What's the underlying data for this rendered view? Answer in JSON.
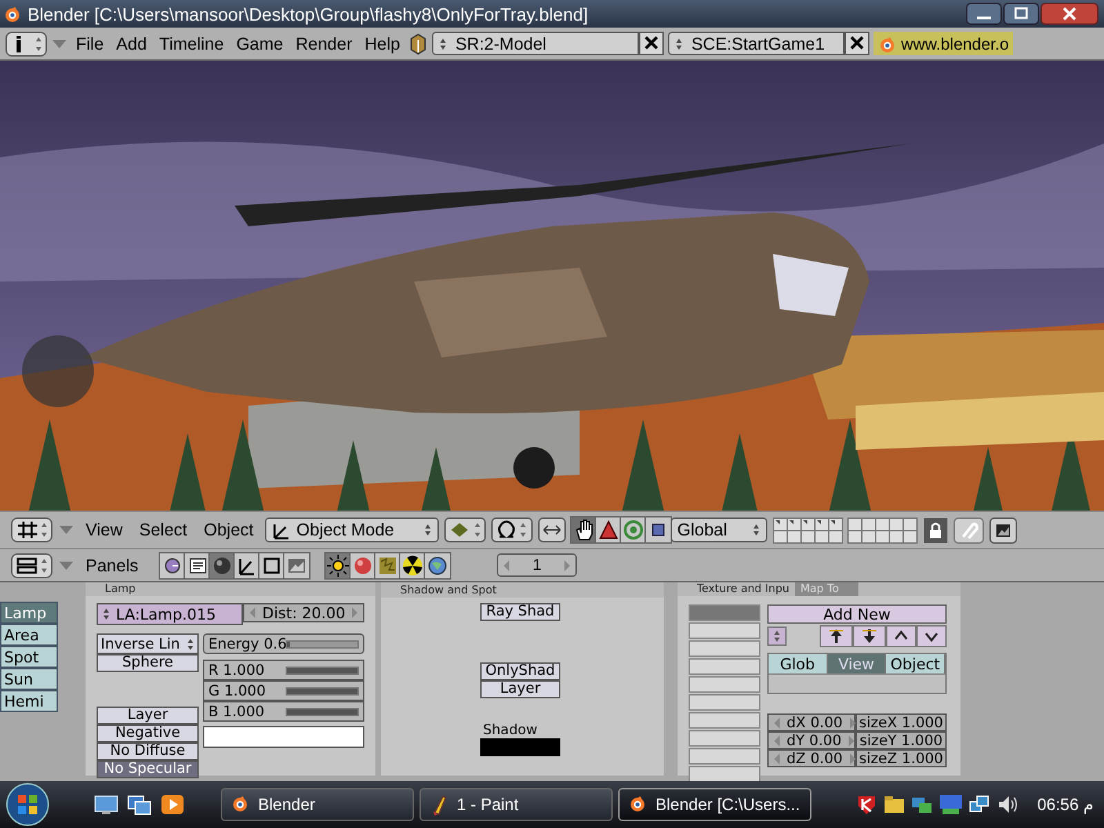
{
  "window": {
    "title": "Blender [C:\\Users\\mansoor\\Desktop\\Group\\flashy8\\OnlyForTray.blend]"
  },
  "info_header": {
    "menus": [
      "File",
      "Add",
      "Timeline",
      "Game",
      "Render",
      "Help"
    ],
    "screen": "SR:2-Model",
    "scene": "SCE:StartGame1",
    "link": "www.blender.o"
  },
  "view3d_header": {
    "menus": [
      "View",
      "Select",
      "Object"
    ],
    "mode": "Object Mode",
    "orientation": "Global",
    "manipulators": [
      {
        "kind": "hand",
        "selected": true
      },
      {
        "kind": "translate",
        "selected": false
      },
      {
        "kind": "rotate",
        "selected": false
      },
      {
        "kind": "scale",
        "selected": false
      }
    ]
  },
  "buttons_header": {
    "label": "Panels",
    "contexts": [
      {
        "kind": "logic",
        "selected": false
      },
      {
        "kind": "script",
        "selected": false
      },
      {
        "kind": "shading",
        "selected": true
      },
      {
        "kind": "object",
        "selected": false
      },
      {
        "kind": "editing",
        "selected": false
      },
      {
        "kind": "scene",
        "selected": false
      }
    ],
    "subcontexts": [
      {
        "kind": "lamp",
        "selected": true
      },
      {
        "kind": "material",
        "selected": false
      },
      {
        "kind": "texture",
        "selected": false
      },
      {
        "kind": "radio",
        "selected": false
      },
      {
        "kind": "world",
        "selected": false
      }
    ],
    "frame": "1"
  },
  "lamp_types": [
    {
      "label": "Lamp",
      "selected": true
    },
    {
      "label": "Area",
      "selected": false
    },
    {
      "label": "Spot",
      "selected": false
    },
    {
      "label": "Sun",
      "selected": false
    },
    {
      "label": "Hemi",
      "selected": false
    }
  ],
  "lamp_panel": {
    "title": "Lamp",
    "name": "LA:Lamp.015",
    "dist": "Dist: 20.00",
    "falloff": "Inverse Lin",
    "sphere": "Sphere",
    "energy": {
      "label": "Energy 0.6",
      "level": 0.03
    },
    "color_sliders": [
      {
        "label": "R 1.000",
        "level": 1
      },
      {
        "label": "G 1.000",
        "level": 1
      },
      {
        "label": "B 1.000",
        "level": 1
      }
    ],
    "color": "#ffffff",
    "toggles": [
      {
        "label": "Layer",
        "on": false
      },
      {
        "label": "Negative",
        "on": false
      },
      {
        "label": "No Diffuse",
        "on": false
      },
      {
        "label": "No Specular",
        "on": true
      }
    ]
  },
  "shadow_panel": {
    "title": "Shadow and Spot",
    "toggles": [
      {
        "label": "Ray Shad",
        "on": false
      },
      {
        "label": "OnlyShad",
        "on": false
      },
      {
        "label": "Layer",
        "on": false
      }
    ],
    "shadow_label": "Shadow"
  },
  "texture_panel": {
    "title": "Texture and Inpu",
    "tab": "Map To",
    "slots": [
      {
        "selected": true
      },
      {
        "selected": false
      },
      {
        "selected": false
      },
      {
        "selected": false
      },
      {
        "selected": false
      },
      {
        "selected": false
      },
      {
        "selected": false
      },
      {
        "selected": false
      },
      {
        "selected": false
      },
      {
        "selected": false
      }
    ],
    "add_new": "Add New",
    "coords": [
      {
        "label": "Glob",
        "selected": false
      },
      {
        "label": "View",
        "selected": true
      },
      {
        "label": "Object",
        "selected": false
      }
    ],
    "offsets": [
      "dX 0.00",
      "dY 0.00",
      "dZ 0.00"
    ],
    "sizes": [
      "sizeX 1.000",
      "sizeY 1.000",
      "sizeZ 1.000"
    ]
  },
  "taskbar": {
    "tasks": [
      {
        "label": "Blender",
        "kind": "blender",
        "selected": false
      },
      {
        "label": "1 - Paint",
        "kind": "paint",
        "selected": false
      },
      {
        "label": "Blender [C:\\Users...",
        "kind": "blender",
        "selected": true
      }
    ],
    "clock": "06:56 م"
  }
}
